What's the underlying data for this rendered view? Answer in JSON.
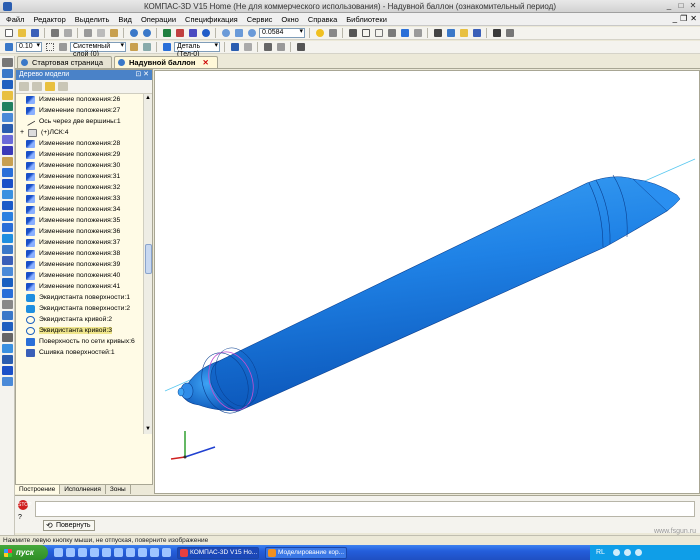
{
  "window": {
    "title": "КОМПАС-3D V15 Home (Не для коммерческого использования) - Надувной баллон (ознакомительный период)"
  },
  "menu": [
    "Файл",
    "Редактор",
    "Выделить",
    "Вид",
    "Операции",
    "Спецификация",
    "Сервис",
    "Окно",
    "Справка",
    "Библиотеки"
  ],
  "toolbar": {
    "zoom_value": "0.0584",
    "line_width": "0.10",
    "layer": "Системный слой (0)",
    "detail": "Деталь (Тел-0)"
  },
  "tabs": [
    {
      "label": "Стартовая страница",
      "active": false
    },
    {
      "label": "Надувной баллон",
      "active": true
    }
  ],
  "tree": {
    "title": "Дерево модели",
    "items": [
      {
        "label": "Изменение положения:26",
        "icon": "position-icon"
      },
      {
        "label": "Изменение положения:27",
        "icon": "position-icon"
      },
      {
        "label": "Ось через две вершины:1",
        "icon": "axis-icon"
      },
      {
        "label": "(+)ЛСК:4",
        "icon": "lcs-icon",
        "expandable": true
      },
      {
        "label": "Изменение положения:28",
        "icon": "position-icon"
      },
      {
        "label": "Изменение положения:29",
        "icon": "position-icon"
      },
      {
        "label": "Изменение положения:30",
        "icon": "position-icon"
      },
      {
        "label": "Изменение положения:31",
        "icon": "position-icon"
      },
      {
        "label": "Изменение положения:32",
        "icon": "position-icon"
      },
      {
        "label": "Изменение положения:33",
        "icon": "position-icon"
      },
      {
        "label": "Изменение положения:34",
        "icon": "position-icon"
      },
      {
        "label": "Изменение положения:35",
        "icon": "position-icon"
      },
      {
        "label": "Изменение положения:36",
        "icon": "position-icon"
      },
      {
        "label": "Изменение положения:37",
        "icon": "position-icon"
      },
      {
        "label": "Изменение положения:38",
        "icon": "position-icon"
      },
      {
        "label": "Изменение положения:39",
        "icon": "position-icon"
      },
      {
        "label": "Изменение положения:40",
        "icon": "position-icon"
      },
      {
        "label": "Изменение положения:41",
        "icon": "position-icon"
      },
      {
        "label": "Эквидистанта поверхности:1",
        "icon": "surface-icon"
      },
      {
        "label": "Эквидистанта поверхности:2",
        "icon": "surface-icon"
      },
      {
        "label": "Эквидистанта кривой:2",
        "icon": "curve-icon"
      },
      {
        "label": "Эквидистанта кривой:3",
        "icon": "curve-icon",
        "selected": true
      },
      {
        "label": "Поверхность по сети кривых:6",
        "icon": "mesh-icon"
      },
      {
        "label": "Сшивка поверхностей:1",
        "icon": "sew-icon"
      }
    ]
  },
  "bottom_tabs": [
    "Построение",
    "Исполнения",
    "Зоны"
  ],
  "property_bar": {
    "rotate_button": "Повернуть"
  },
  "status": "Нажмите левую кнопку мыши, не отпуская, поверните изображение",
  "taskbar": {
    "start_label": "пуск",
    "tasks": [
      {
        "label": "КОМПАС-3D V15 Ho...",
        "active": true
      },
      {
        "label": "Моделирование кор...",
        "active": false
      }
    ],
    "lang": "RL"
  },
  "watermark": "www.fsgun.ru",
  "colors": {
    "model_blue": "#1e7fe6",
    "model_dark": "#0a4fb0",
    "axis_cyan": "#58c8f0",
    "accent_magenta": "#c050d0"
  }
}
